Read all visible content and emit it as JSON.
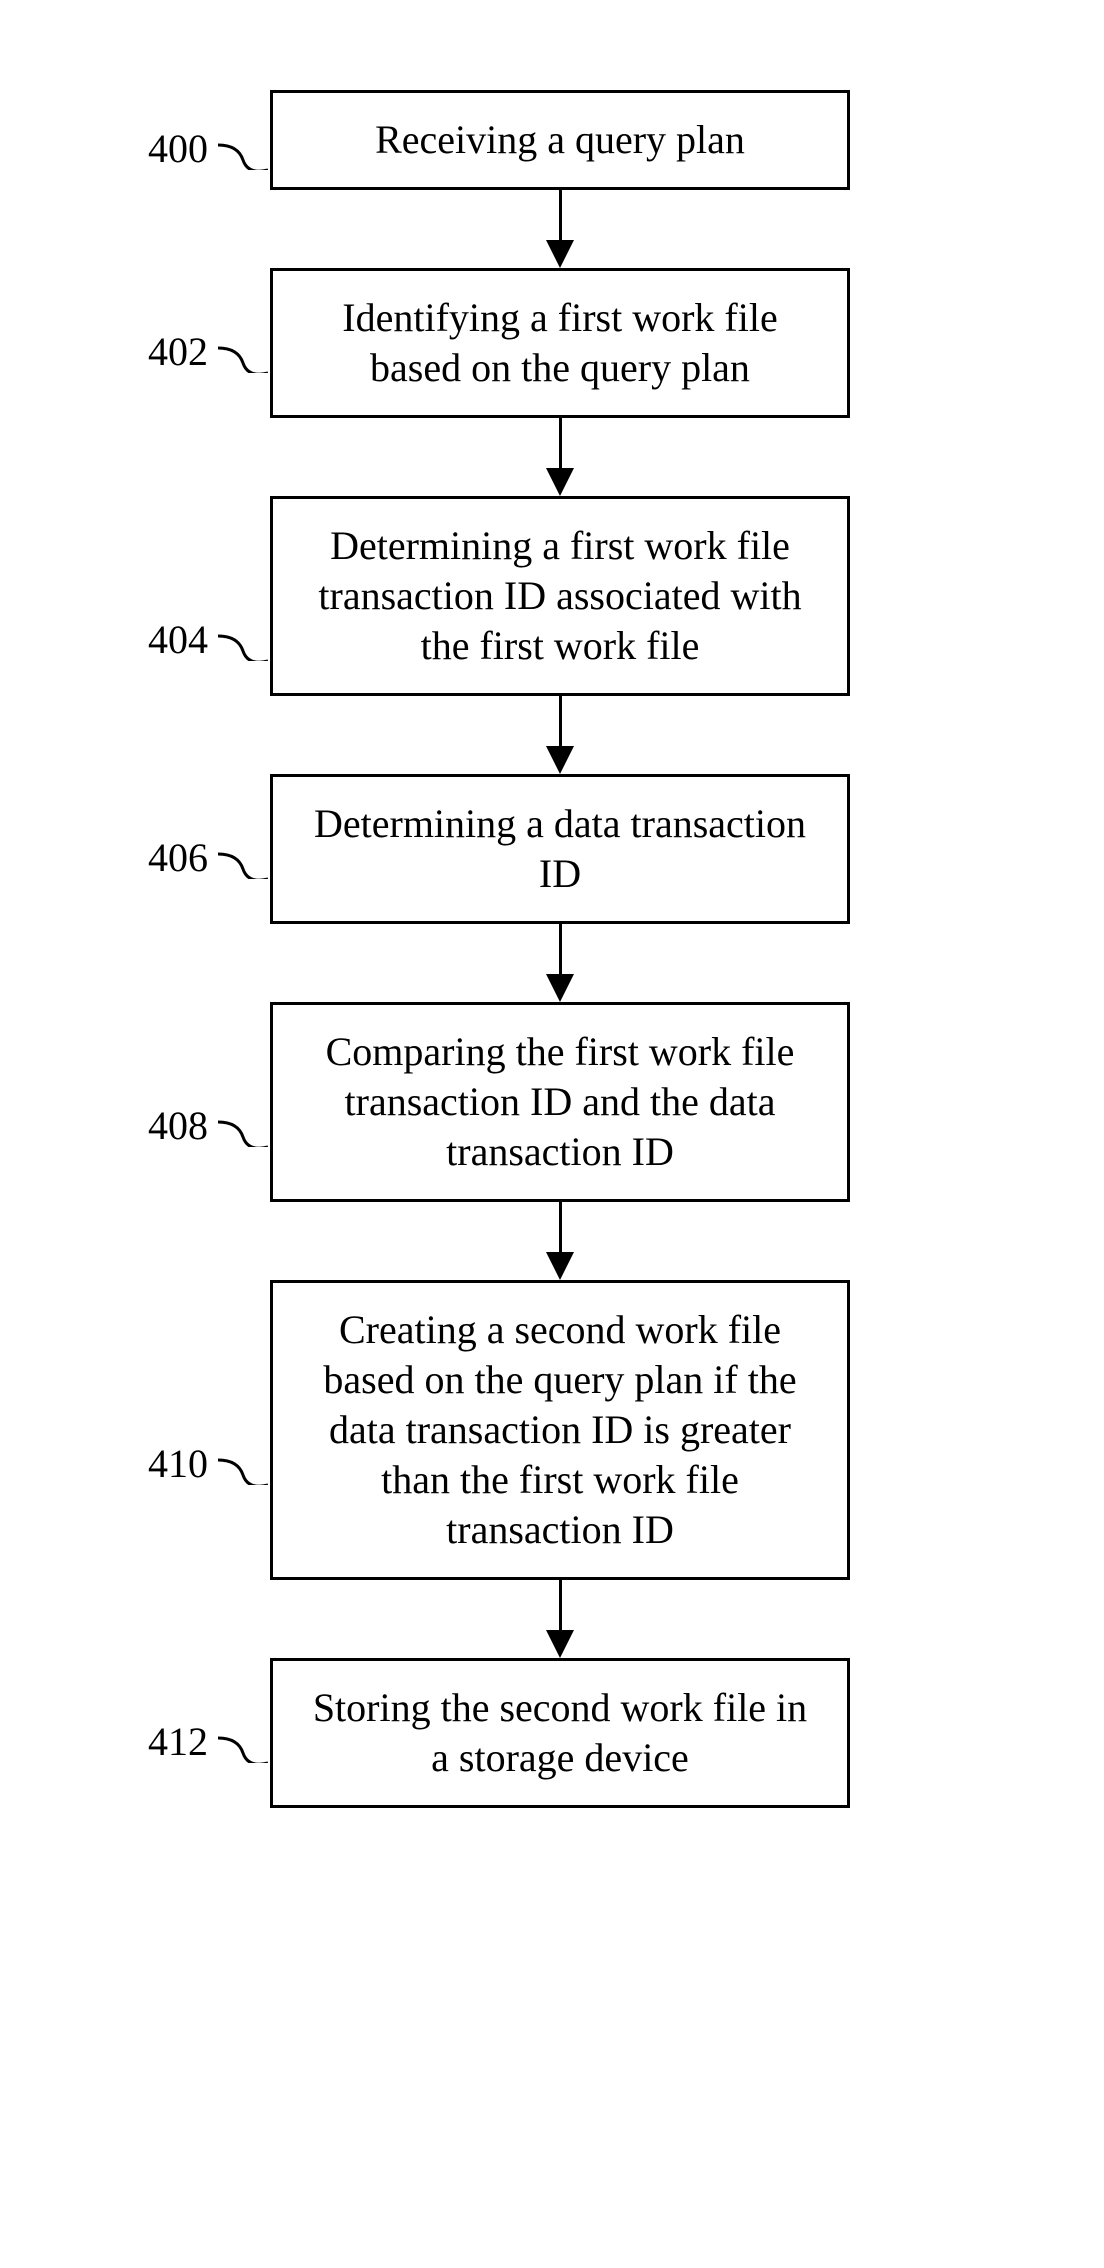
{
  "steps": [
    {
      "label": "400",
      "text": "Receiving a query plan",
      "labelTop": 35
    },
    {
      "label": "402",
      "text": "Identifying a first work file based on the query plan",
      "labelTop": 60
    },
    {
      "label": "404",
      "text": "Determining a first work file transaction ID associated with the first work file",
      "labelTop": 120
    },
    {
      "label": "406",
      "text": "Determining a data transaction ID",
      "labelTop": 60
    },
    {
      "label": "408",
      "text": "Comparing the first work file transaction ID and the data transaction ID",
      "labelTop": 100
    },
    {
      "label": "410",
      "text": "Creating a second work file based on the query plan if the data transaction ID is greater than the first work file transaction ID",
      "labelTop": 160
    },
    {
      "label": "412",
      "text": "Storing the second work file in a storage device",
      "labelTop": 60
    }
  ]
}
